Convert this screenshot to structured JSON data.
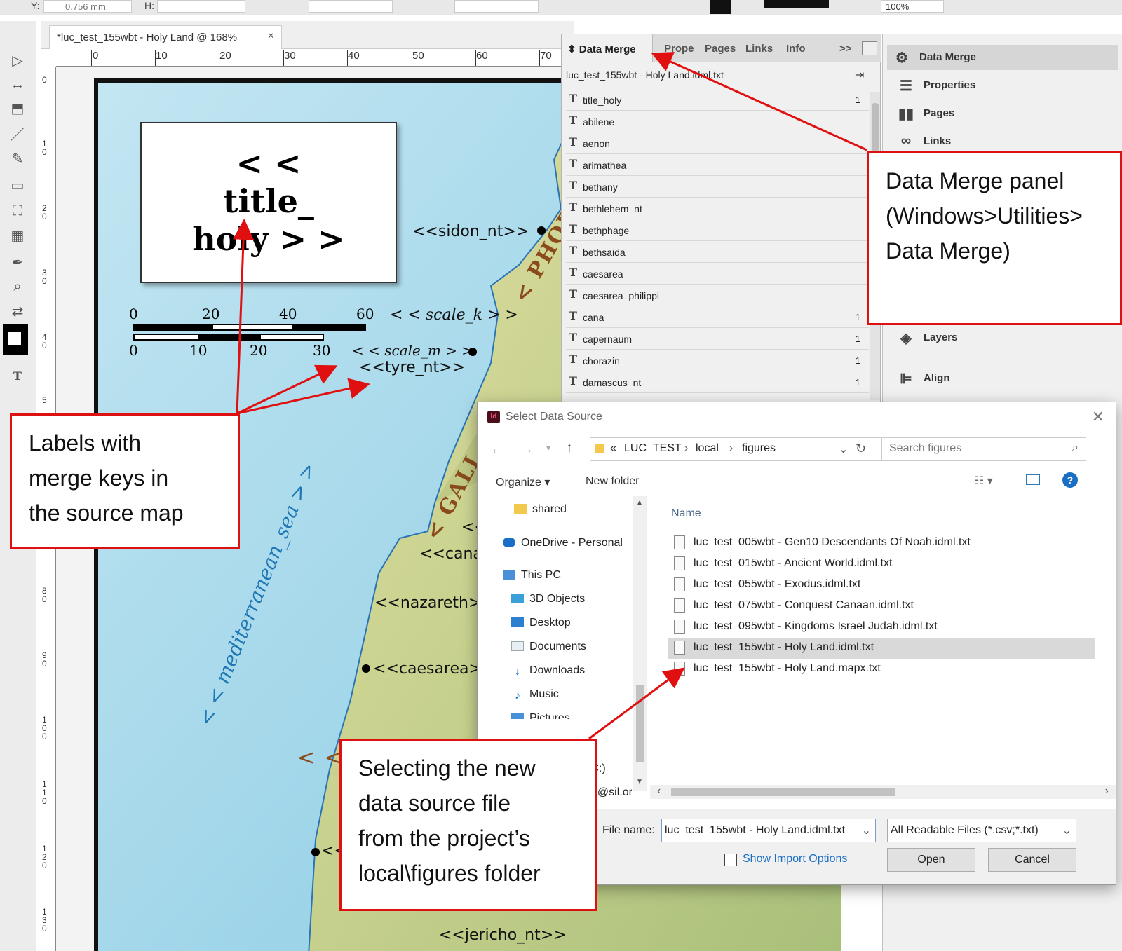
{
  "control_bar": {
    "y_label": "Y:",
    "y_value": "0.756 mm",
    "h_label": "H:",
    "zoom": "100%"
  },
  "document_tab": {
    "title": "*luc_test_155wbt - Holy Land @ 168%",
    "close": "×"
  },
  "ruler": {
    "h_ticks": [
      "0",
      "10",
      "20",
      "30",
      "40",
      "50",
      "60",
      "70"
    ],
    "v_ticks": [
      "0",
      "1 0",
      "2 0",
      "3 0",
      "4 0",
      "5",
      "8 0",
      "9 0",
      "1 0 0",
      "1 1 0",
      "1 2 0",
      "1 3 0"
    ]
  },
  "map": {
    "title_field": "< < title_ holy > >",
    "labels": {
      "sidon": "<<sidon_nt>>",
      "scale_k": "< < scale_k > >",
      "scale_m": "< < scale_m > >",
      "tyre": "<<tyre_nt>>",
      "cana": "<<cana>",
      "nazareth": "<<nazareth>",
      "caesarea": "<<caesarea>",
      "jericho": "<<jericho_nt>>",
      "chevrons_1": "<<",
      "chevrons_2": "< <",
      "chevrons_3": "<<",
      "sea": "< < mediterranean_sea > >",
      "phoenicia": "< PHOEN",
      "galilee": "< GALI"
    },
    "scale_top": [
      "0",
      "20",
      "40",
      "60"
    ],
    "scale_bottom": [
      "0",
      "10",
      "20",
      "30"
    ]
  },
  "data_merge_panel": {
    "tabs": [
      {
        "label": "Data Merge"
      },
      {
        "label": "Prope"
      },
      {
        "label": "Pages"
      },
      {
        "label": "Links"
      },
      {
        "label": "Info"
      }
    ],
    "more": ">>",
    "source_file": "luc_test_155wbt - Holy Land.idml.txt",
    "fields": [
      {
        "name": "title_holy",
        "count": "1"
      },
      {
        "name": "abilene",
        "count": ""
      },
      {
        "name": "aenon",
        "count": ""
      },
      {
        "name": "arimathea",
        "count": ""
      },
      {
        "name": "bethany",
        "count": ""
      },
      {
        "name": "bethlehem_nt",
        "count": ""
      },
      {
        "name": "bethphage",
        "count": ""
      },
      {
        "name": "bethsaida",
        "count": ""
      },
      {
        "name": "caesarea",
        "count": ""
      },
      {
        "name": "caesarea_philippi",
        "count": ""
      },
      {
        "name": "cana",
        "count": "1"
      },
      {
        "name": "capernaum",
        "count": "1"
      },
      {
        "name": "chorazin",
        "count": "1"
      },
      {
        "name": "damascus_nt",
        "count": "1"
      }
    ]
  },
  "dock": {
    "items": [
      {
        "label": "Data Merge",
        "icon": "data-merge-icon"
      },
      {
        "label": "Properties",
        "icon": "properties-icon"
      },
      {
        "label": "Pages",
        "icon": "pages-icon"
      },
      {
        "label": "Links",
        "icon": "links-icon"
      },
      {
        "label": "Layers",
        "icon": "layers-icon"
      },
      {
        "label": "Align",
        "icon": "align-icon"
      }
    ]
  },
  "dialog": {
    "title": "Select Data Source",
    "app_badge": "Id",
    "path": {
      "prefix": "«",
      "parts": [
        "LUC_TEST",
        "local",
        "figures"
      ]
    },
    "search_placeholder": "Search figures",
    "organize": "Organize",
    "new_folder": "New folder",
    "nav": [
      {
        "label": "shared"
      },
      {
        "label": "OneDrive - Personal"
      },
      {
        "label": "This PC"
      },
      {
        "label": "3D Objects"
      },
      {
        "label": "Desktop"
      },
      {
        "label": "Documents"
      },
      {
        "label": "Downloads"
      },
      {
        "label": "Music"
      },
      {
        "label": "Pictures"
      },
      {
        "label": "(C:)"
      },
      {
        "label": "ce@sil.org"
      }
    ],
    "column_name": "Name",
    "files": [
      {
        "name": "luc_test_005wbt - Gen10 Descendants Of Noah.idml.txt"
      },
      {
        "name": "luc_test_015wbt - Ancient World.idml.txt"
      },
      {
        "name": "luc_test_055wbt - Exodus.idml.txt"
      },
      {
        "name": "luc_test_075wbt - Conquest Canaan.idml.txt"
      },
      {
        "name": "luc_test_095wbt - Kingdoms Israel Judah.idml.txt"
      },
      {
        "name": "luc_test_155wbt - Holy Land.idml.txt",
        "selected": true
      },
      {
        "name": "luc_test_155wbt - Holy Land.mapx.txt"
      }
    ],
    "file_name_label": "File name:",
    "file_name_value": "luc_test_155wbt - Holy Land.idml.txt",
    "file_type": "All Readable Files (*.csv;*.txt)",
    "show_import_options": "Show Import Options",
    "open": "Open",
    "cancel": "Cancel"
  },
  "callouts": {
    "data_merge_panel": [
      "Data Merge panel",
      "(Windows>Utilities>",
      "Data Merge)"
    ],
    "labels_with_keys": [
      "Labels with",
      "merge keys in",
      "the source map"
    ],
    "selecting_source": [
      "Selecting the new",
      "data source file",
      "from the project’s",
      "local\\figures folder"
    ]
  },
  "colors": {
    "callout_border": "#d11111",
    "arrow": "#e01010",
    "sea": "#a8d8ea",
    "land": "#d6d49a",
    "region_text": "#8a4a1c",
    "sea_text": "#1f78b4"
  }
}
